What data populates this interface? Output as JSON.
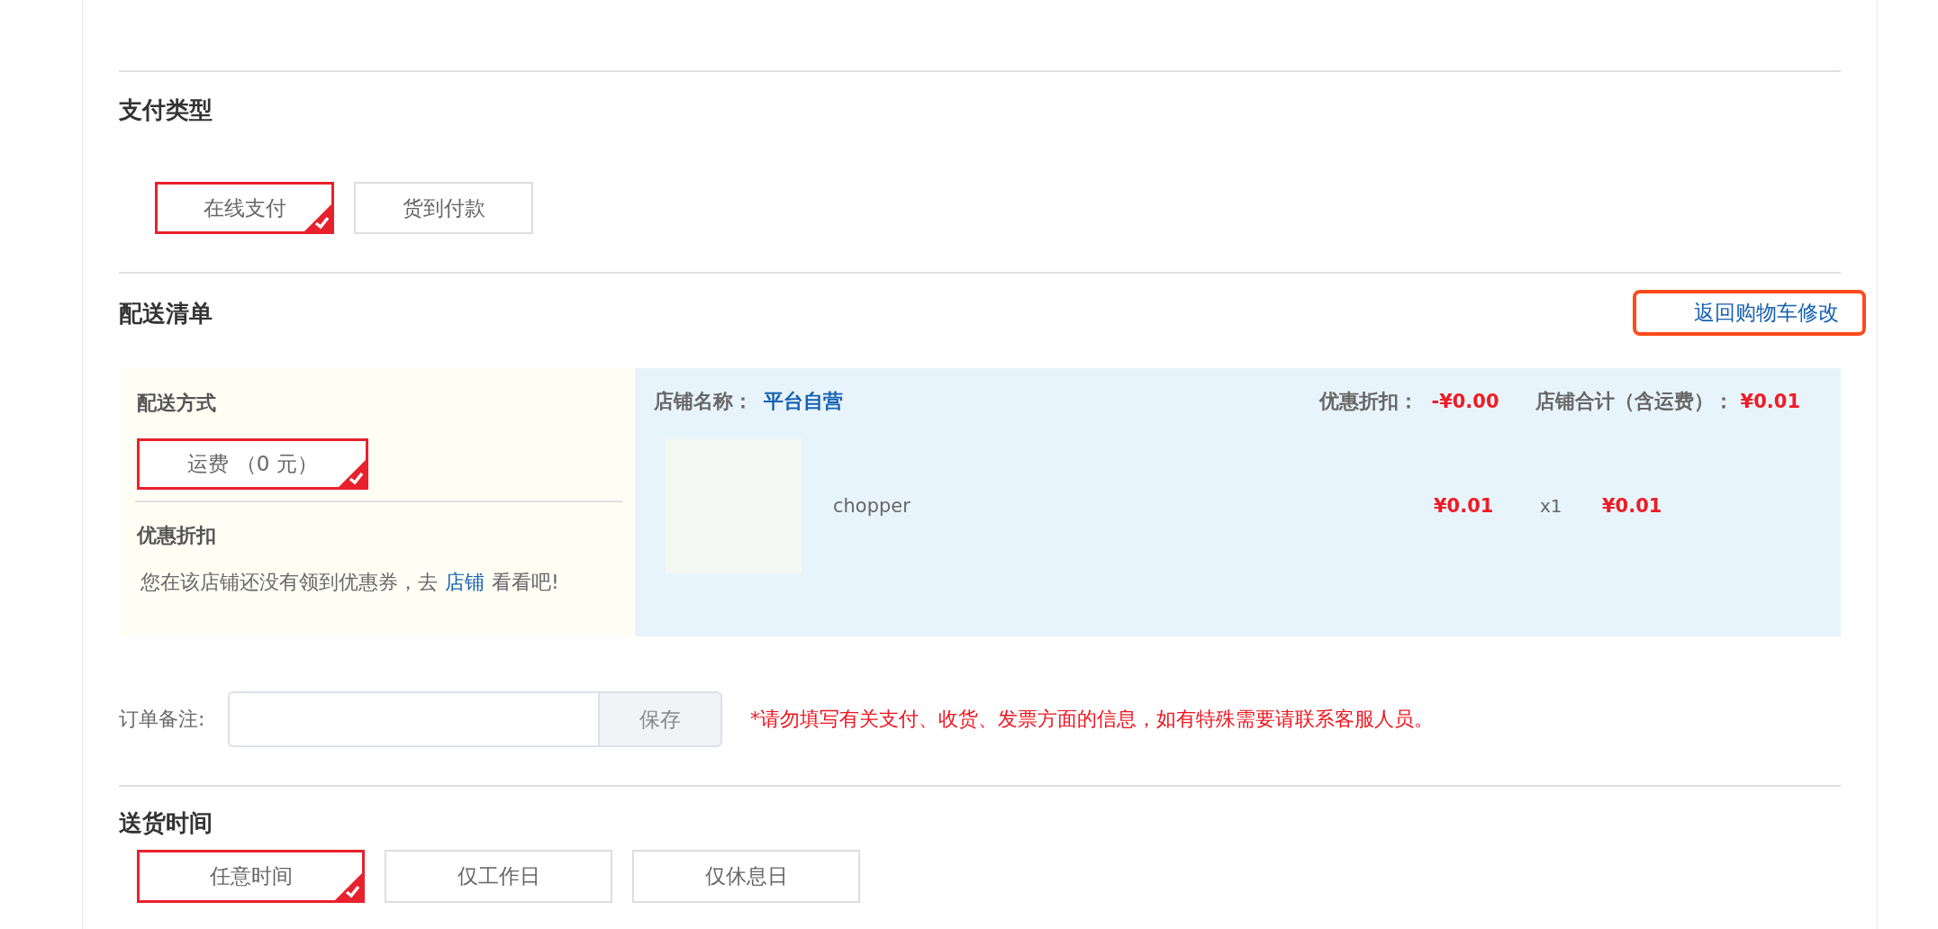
{
  "payment": {
    "title": "支付类型",
    "options": [
      {
        "label": "在线支付",
        "selected": true
      },
      {
        "label": "货到付款",
        "selected": false
      }
    ]
  },
  "delivery": {
    "title": "配送清单",
    "back_link": "返回购物车修改",
    "method": {
      "title": "配送方式",
      "options": [
        {
          "label": "运费 （0 元）",
          "selected": true
        }
      ]
    },
    "discount": {
      "title": "优惠折扣",
      "message_before": "您在该店铺还没有领到优惠券，去",
      "link": "店铺",
      "message_after": "看看吧!"
    },
    "store": {
      "name_label": "店铺名称：",
      "name": "平台自营",
      "discount_label": "优惠折扣：",
      "discount": "-¥0.00",
      "total_label": "店铺合计（含运费）：",
      "total": "¥0.01",
      "items": [
        {
          "name": "chopper",
          "price": "¥0.01",
          "quantity": "x1",
          "subtotal": "¥0.01"
        }
      ]
    }
  },
  "note": {
    "label": "订单备注:",
    "save": "保存",
    "warning": "*请勿填写有关支付、收货、发票方面的信息，如有特殊需要请联系客服人员。"
  },
  "delivery_time": {
    "title": "送货时间",
    "options": [
      {
        "label": "任意时间",
        "selected": true
      },
      {
        "label": "仅工作日",
        "selected": false
      },
      {
        "label": "仅休息日",
        "selected": false
      }
    ]
  }
}
